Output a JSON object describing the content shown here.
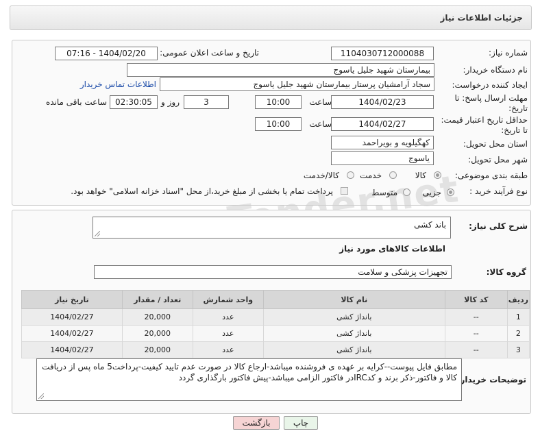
{
  "header": {
    "title": "جزئیات اطلاعات نیاز"
  },
  "form": {
    "need_number_label": "شماره نیاز:",
    "need_number": "1104030712000088",
    "announce_label": "تاریخ و ساعت اعلان عمومی:",
    "announce_value": "1404/02/20 - 07:16",
    "buyer_org_label": "نام دستگاه خریدار:",
    "buyer_org": "بیمارستان شهید جلیل یاسوج",
    "creator_label": "ایجاد کننده درخواست:",
    "creator": "سجاد آرامشیان پرستار بیمارستان شهید جلیل یاسوج",
    "contact_link": "اطلاعات تماس خریدار",
    "deadline_label_1": "مهلت ارسال پاسخ: تا",
    "deadline_label_2": "تاریخ:",
    "deadline_date": "1404/02/23",
    "time_label": "ساعت",
    "deadline_time": "10:00",
    "days_value": "3",
    "days_label": "روز و",
    "remaining_time": "02:30:05",
    "remaining_label": "ساعت باقی مانده",
    "price_label_1": "حداقل تاریخ اعتبار قیمت:",
    "price_label_2": "تا تاریخ:",
    "price_date": "1404/02/27",
    "price_time_label": "ساعت",
    "price_time": "10:00",
    "province_label": "استان محل تحویل:",
    "province": "کهگیلویه و بویراحمد",
    "city_label": "شهر محل تحویل:",
    "city": "یاسوج",
    "category_label": "طبقه بندی موضوعی:",
    "category_options": [
      "کالا",
      "خدمت",
      "کالا/خدمت"
    ],
    "category_selected": "کالا",
    "process_label": "نوع فرآیند خرید :",
    "process_options": [
      "جزیی",
      "متوسط"
    ],
    "process_selected": "جزیی",
    "payment_note": "پرداخت تمام یا بخشی از مبلغ خرید،از محل \"اسناد خزانه اسلامی\" خواهد بود."
  },
  "summary": {
    "label": "شرح کلی نیاز:",
    "value": "باند کشی",
    "goods_heading": "اطلاعات کالاهای مورد نیاز",
    "group_label": "گروه کالا:",
    "group_value": "تجهیزات پزشکی و سلامت"
  },
  "table": {
    "headers": [
      "ردیف",
      "کد کالا",
      "نام کالا",
      "واحد شمارش",
      "تعداد / مقدار",
      "تاریخ نیاز"
    ],
    "rows": [
      [
        "1",
        "--",
        "بانداژ کشی",
        "عدد",
        "20,000",
        "1404/02/27"
      ],
      [
        "2",
        "--",
        "بانداژ کشی",
        "عدد",
        "20,000",
        "1404/02/27"
      ],
      [
        "3",
        "--",
        "بانداژ کشی",
        "عدد",
        "20,000",
        "1404/02/27"
      ]
    ]
  },
  "notes": {
    "label": "توضیحات خریدار:",
    "text": "مطابق فایل پیوست--کرایه بر عهده ی فروشنده میباشد-ارجاع کالا در صورت عدم تایید کیفیت-پرداخت5 ماه پس از دریافت کالا و فاکتور-ذکر برند و کدIRCدر فاکتور الزامی میباشد-پیش فاکتور بارگذاری گردد"
  },
  "buttons": {
    "print": "چاپ",
    "back": "بازگشت"
  },
  "watermark": "AriaTender.net",
  "colors": {
    "link": "#1a4aa8",
    "back_button": "#f6d4d4",
    "print_button": "#e9f5e9"
  }
}
